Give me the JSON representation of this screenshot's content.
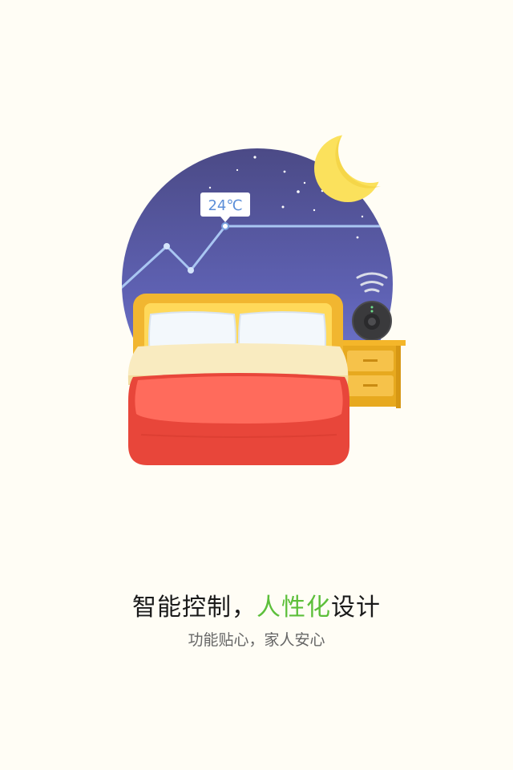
{
  "illustration": {
    "temperature_label": "24℃"
  },
  "onboarding": {
    "headline_part1": "智能控制，",
    "headline_accent": "人性化",
    "headline_part2": "设计",
    "subtitle": "功能贴心，家人安心"
  },
  "colors": {
    "background": "#fffdf5",
    "accent": "#5cbf3a",
    "headline": "#1a1a1a",
    "subtitle": "#666666"
  }
}
